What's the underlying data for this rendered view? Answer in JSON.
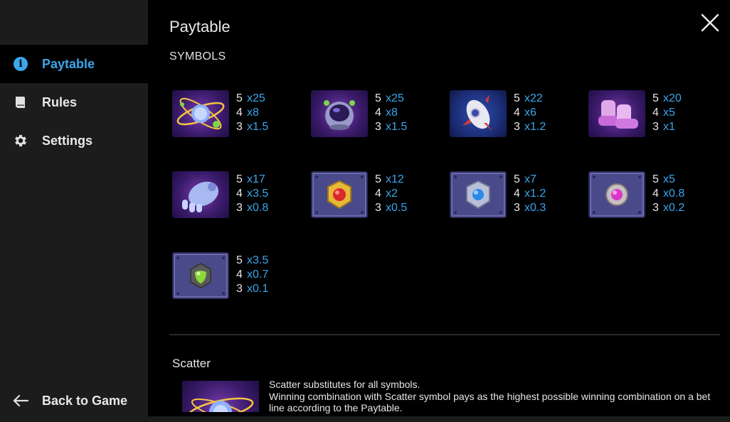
{
  "sidebar": {
    "items": [
      {
        "label": "Paytable",
        "icon": "info-icon",
        "active": true
      },
      {
        "label": "Rules",
        "icon": "book-icon",
        "active": false
      },
      {
        "label": "Settings",
        "icon": "gear-icon",
        "active": false
      }
    ],
    "back_label": "Back to Game"
  },
  "main": {
    "title": "Paytable",
    "section": "SYMBOLS",
    "close_icon": "close-icon"
  },
  "symbols": [
    {
      "icon": "atom-planet-icon",
      "pays": [
        {
          "n": "5",
          "m": "x25"
        },
        {
          "n": "4",
          "m": "x8"
        },
        {
          "n": "3",
          "m": "x1.5"
        }
      ]
    },
    {
      "icon": "alien-helmet-icon",
      "pays": [
        {
          "n": "5",
          "m": "x25"
        },
        {
          "n": "4",
          "m": "x8"
        },
        {
          "n": "3",
          "m": "x1.5"
        }
      ]
    },
    {
      "icon": "rocket-icon",
      "pays": [
        {
          "n": "5",
          "m": "x22"
        },
        {
          "n": "4",
          "m": "x6"
        },
        {
          "n": "3",
          "m": "x1.2"
        }
      ]
    },
    {
      "icon": "space-boots-icon",
      "pays": [
        {
          "n": "5",
          "m": "x20"
        },
        {
          "n": "4",
          "m": "x5"
        },
        {
          "n": "3",
          "m": "x1"
        }
      ]
    },
    {
      "icon": "space-glove-icon",
      "pays": [
        {
          "n": "5",
          "m": "x17"
        },
        {
          "n": "4",
          "m": "x3.5"
        },
        {
          "n": "3",
          "m": "x0.8"
        }
      ]
    },
    {
      "icon": "red-gem-icon",
      "pays": [
        {
          "n": "5",
          "m": "x12"
        },
        {
          "n": "4",
          "m": "x2"
        },
        {
          "n": "3",
          "m": "x0.5"
        }
      ]
    },
    {
      "icon": "blue-gem-icon",
      "pays": [
        {
          "n": "5",
          "m": "x7"
        },
        {
          "n": "4",
          "m": "x1.2"
        },
        {
          "n": "3",
          "m": "x0.3"
        }
      ]
    },
    {
      "icon": "pink-gem-icon",
      "pays": [
        {
          "n": "5",
          "m": "x5"
        },
        {
          "n": "4",
          "m": "x0.8"
        },
        {
          "n": "3",
          "m": "x0.2"
        }
      ]
    },
    {
      "icon": "green-gem-icon",
      "pays": [
        {
          "n": "5",
          "m": "x3.5"
        },
        {
          "n": "4",
          "m": "x0.7"
        },
        {
          "n": "3",
          "m": "x0.1"
        }
      ]
    }
  ],
  "scatter": {
    "title": "Scatter",
    "line1": "Scatter substitutes for all symbols.",
    "line2": "Winning combination with Scatter symbol pays as the highest possible winning combination on a bet line according to the Paytable."
  },
  "colors": {
    "accent": "#3aa6ec",
    "sidebar_bg": "#1c1c1c",
    "main_bg": "#000000"
  }
}
